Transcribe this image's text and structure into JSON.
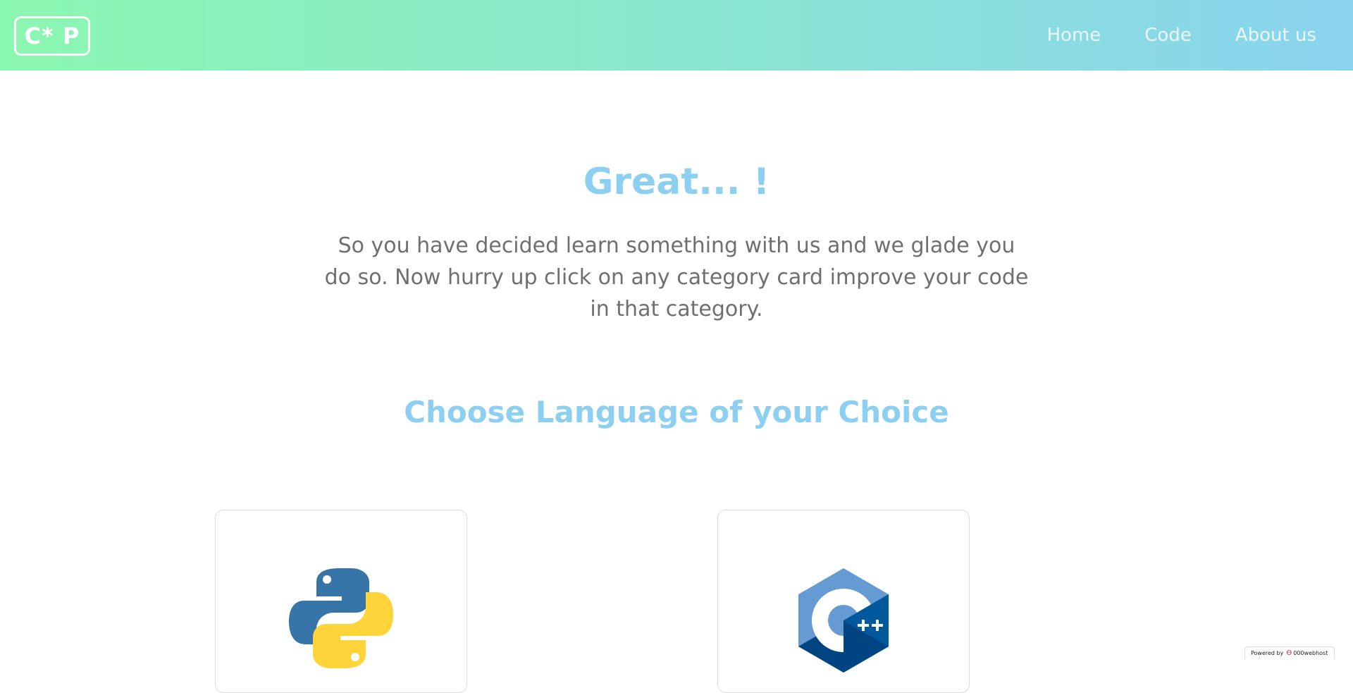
{
  "header": {
    "logo_text": "C* P",
    "nav": [
      {
        "label": "Home"
      },
      {
        "label": "Code"
      },
      {
        "label": "About us"
      }
    ]
  },
  "hero": {
    "title": "Great... !",
    "text": "So you have decided learn something with us and we glade you do so. Now hurry up click on any category card improve your code in that category."
  },
  "languages": {
    "title": "Choose Language of your Choice",
    "cards": [
      {
        "icon": "python-logo-icon"
      },
      {
        "icon": "cpp-logo-icon"
      }
    ]
  },
  "footer_badge": {
    "prefix": "Powered by",
    "brand": "000webhost"
  }
}
